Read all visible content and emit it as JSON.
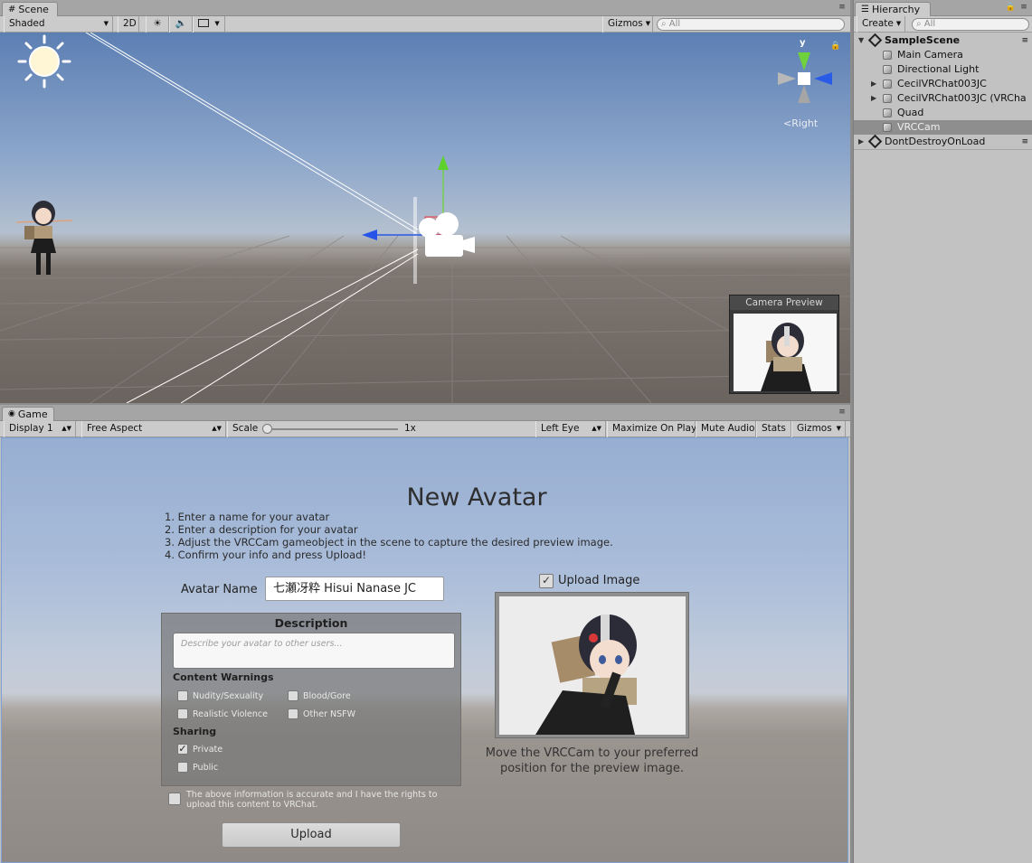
{
  "scene": {
    "tab_label": "Scene",
    "toolbar": {
      "shading_mode": "Shaded",
      "mode_2d": "2D",
      "gizmos": "Gizmos",
      "search_placeholder": "All"
    },
    "orientation_label": "Right",
    "axis_y": "y",
    "camera_preview_title": "Camera Preview"
  },
  "hierarchy": {
    "tab_label": "Hierarchy",
    "create_label": "Create",
    "search_placeholder": "All",
    "scene_name": "SampleScene",
    "items": [
      {
        "label": "Main Camera"
      },
      {
        "label": "Directional Light"
      },
      {
        "label": "CecilVRChat003JC"
      },
      {
        "label": "CecilVRChat003JC (VRCha"
      },
      {
        "label": "Quad"
      },
      {
        "label": "VRCCam"
      }
    ],
    "dont_destroy": "DontDestroyOnLoad"
  },
  "game": {
    "tab_label": "Game",
    "toolbar": {
      "display": "Display 1",
      "aspect": "Free Aspect",
      "scale_label": "Scale",
      "scale_value": "1x",
      "eye": "Left Eye",
      "maximize": "Maximize On Play",
      "mute": "Mute Audio",
      "stats": "Stats",
      "gizmos": "Gizmos"
    }
  },
  "avatar_form": {
    "title": "New Avatar",
    "instructions": [
      "1. Enter a name for your avatar",
      "2. Enter a description for your avatar",
      "3. Adjust the VRCCam gameobject in the scene to capture the desired preview image.",
      "4. Confirm your info and press Upload!"
    ],
    "name_label": "Avatar Name",
    "name_value": "七瀬冴粋 Hisui Nanase JC",
    "description_title": "Description",
    "description_placeholder": "Describe your avatar to other users...",
    "content_warnings_label": "Content Warnings",
    "warnings": [
      "Nudity/Sexuality",
      "Blood/Gore",
      "Realistic Violence",
      "Other NSFW"
    ],
    "sharing_label": "Sharing",
    "sharing_options": [
      "Private",
      "Public"
    ],
    "sharing_selected": "Private",
    "accept_text": "The above information is accurate and I have the rights to upload this content to VRChat.",
    "upload_button": "Upload",
    "upload_image_label": "Upload Image",
    "upload_image_checked": true,
    "preview_caption": "Move the VRCCam to your preferred position for the preview image."
  }
}
